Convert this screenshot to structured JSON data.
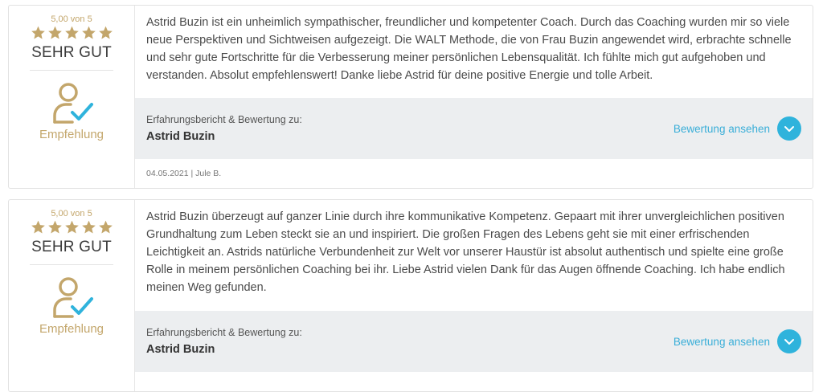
{
  "reviews": [
    {
      "score": "5,00 von 5",
      "rating_word": "SEHR GUT",
      "recommendation": "Empfehlung",
      "text": "Astrid Buzin ist ein unheimlich sympathischer, freundlicher und kompetenter Coach. Durch das Coaching wurden mir so viele neue Perspektiven und Sichtweisen aufgezeigt. Die WALT Methode, die von Frau Buzin angewendet wird, erbrachte schnelle und sehr gute Fortschritte für die Verbesserung meiner persönlichen Lebensqualität. Ich fühlte mich gut aufgehoben und verstanden. Absolut empfehlenswert! Danke liebe Astrid für deine positive Energie und tolle Arbeit.",
      "about_kicker": "Erfahrungsbericht & Bewertung zu:",
      "about_name": "Astrid Buzin",
      "view_label": "Bewertung ansehen",
      "footer": "04.05.2021 | Jule B."
    },
    {
      "score": "5,00 von 5",
      "rating_word": "SEHR GUT",
      "recommendation": "Empfehlung",
      "text": "Astrid Buzin überzeugt auf ganzer Linie durch ihre kommunikative Kompetenz. Gepaart mit ihrer unvergleichlichen positiven Grundhaltung zum Leben steckt sie an und inspiriert. Die großen Fragen des Lebens geht sie mit einer erfrischenden Leichtigkeit an. Astrids natürliche Verbundenheit zur Welt vor unserer Haustür ist absolut authentisch und spielte eine große Rolle in meinem persönlichen Coaching bei ihr. Liebe Astrid vielen Dank für das Augen öffnende Coaching. Ich habe endlich meinen Weg gefunden.",
      "about_kicker": "Erfahrungsbericht & Bewertung zu:",
      "about_name": "Astrid Buzin",
      "view_label": "Bewertung ansehen"
    }
  ],
  "colors": {
    "gold": "#c3a66b",
    "accent": "#2fb3dc",
    "panel": "#eceef0"
  },
  "icons": {
    "star": "star-icon",
    "recommend": "user-check-icon",
    "expand": "chevron-down-icon"
  }
}
